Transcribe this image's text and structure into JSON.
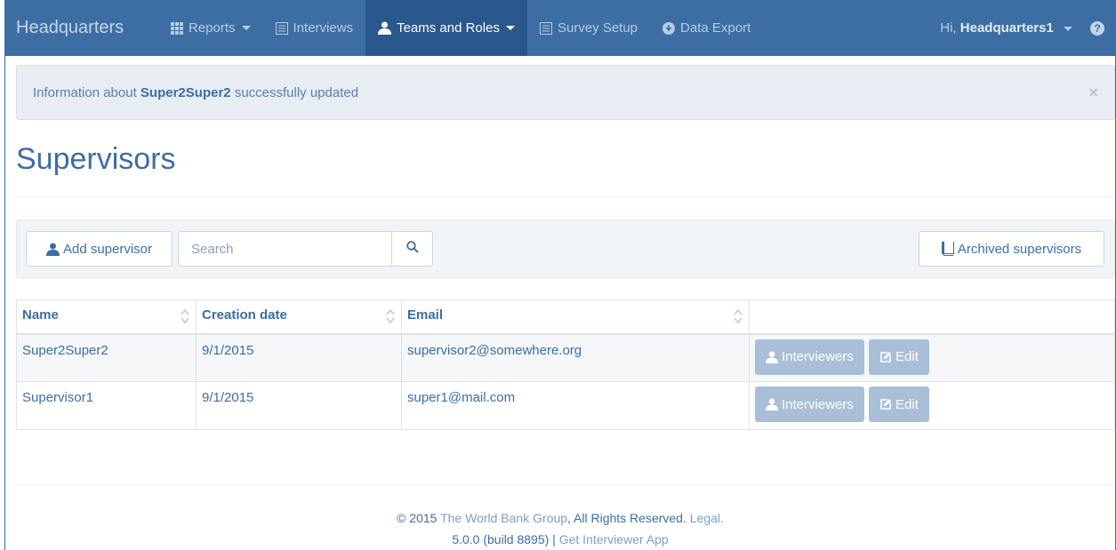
{
  "nav": {
    "brand": "Headquarters",
    "items": [
      {
        "label": "Reports",
        "icon": "grid-icon",
        "dropdown": true,
        "active": false
      },
      {
        "label": "Interviews",
        "icon": "list-icon",
        "dropdown": false,
        "active": false
      },
      {
        "label": "Teams and Roles",
        "icon": "user-icon",
        "dropdown": true,
        "active": true
      },
      {
        "label": "Survey Setup",
        "icon": "list-icon",
        "dropdown": false,
        "active": false
      },
      {
        "label": "Data Export",
        "icon": "download-circle-icon",
        "dropdown": false,
        "active": false
      }
    ],
    "greeting": "Hi,",
    "username": "Headquarters1"
  },
  "alert": {
    "prefix": "Information about",
    "name": "Super2Super2",
    "suffix": "successfully updated",
    "close": "×"
  },
  "page": {
    "title": "Supervisors"
  },
  "toolbar": {
    "add_label": "Add supervisor",
    "search_placeholder": "Search",
    "archived_label": "Archived supervisors"
  },
  "table": {
    "columns": [
      "Name",
      "Creation date",
      "Email"
    ],
    "rows": [
      {
        "name": "Super2Super2",
        "created": "9/1/2015",
        "email": "supervisor2@somewhere.org"
      },
      {
        "name": "Supervisor1",
        "created": "9/1/2015",
        "email": "super1@mail.com"
      }
    ],
    "interviewers_label": "Interviewers",
    "edit_label": "Edit"
  },
  "footer": {
    "copyright": "© 2015",
    "org": "The World Bank Group",
    "rights": ", All Rights Reserved.",
    "legal": "Legal.",
    "version": "5.0.0 (build 8895) |",
    "app_link": "Get Interviewer App"
  },
  "colors": {
    "navbar": "#3d6ea3",
    "nav_active": "#2a578c",
    "accent": "#3d6ea3",
    "row_button": "#a9bfd8",
    "alert_bg": "#e7edf3"
  }
}
